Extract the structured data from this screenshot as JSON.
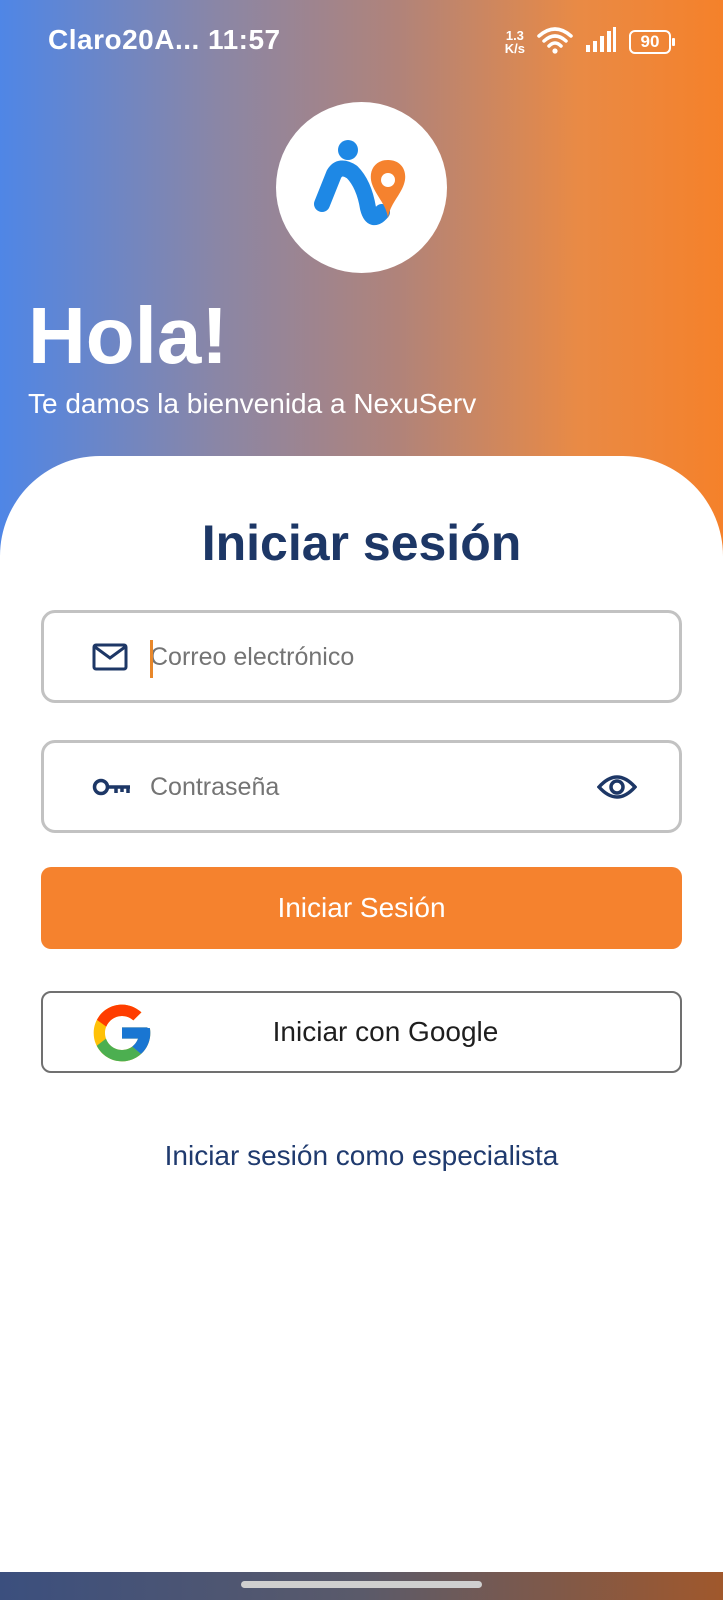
{
  "status_bar": {
    "carrier_time": "Claro20A... 11:57",
    "net_speed_value": "1.3",
    "net_speed_unit": "K/s",
    "battery": "90"
  },
  "header": {
    "greeting": "Hola!",
    "welcome": "Te damos la bienvenida a NexuServ"
  },
  "login": {
    "title": "Iniciar sesión",
    "email_placeholder": "Correo electrónico",
    "password_placeholder": "Contraseña",
    "submit_label": "Iniciar Sesión",
    "google_label": "Iniciar con Google",
    "specialist_link": "Iniciar sesión como especialista"
  },
  "colors": {
    "primary_orange": "#f5822e",
    "navy": "#1d3766",
    "brand_blue": "#1e88e5",
    "brand_orange": "#f5822e"
  },
  "icons": {
    "email": "mail-icon",
    "password": "key-icon",
    "show_password": "eye-icon",
    "google": "google-logo-icon"
  }
}
